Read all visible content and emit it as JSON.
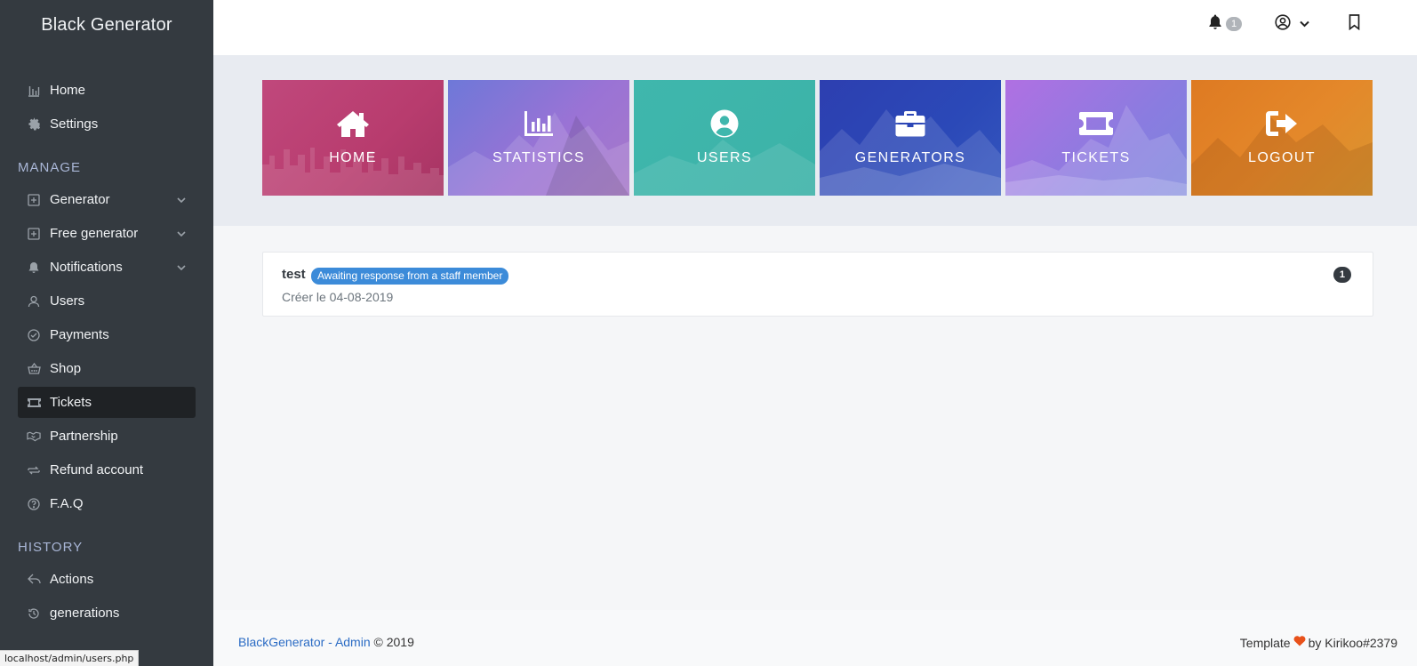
{
  "brand": "Black Generator",
  "nav_main": [
    {
      "label": "Home",
      "icon": "bar-chart-icon"
    },
    {
      "label": "Settings",
      "icon": "gear-icon"
    }
  ],
  "manage": {
    "heading": "MANAGE",
    "items": [
      {
        "label": "Generator",
        "icon": "plus-square-icon",
        "expandable": true
      },
      {
        "label": "Free generator",
        "icon": "plus-square-icon",
        "expandable": true
      },
      {
        "label": "Notifications",
        "icon": "bell-icon",
        "expandable": true
      },
      {
        "label": "Users",
        "icon": "user-icon"
      },
      {
        "label": "Payments",
        "icon": "check-circle-icon"
      },
      {
        "label": "Shop",
        "icon": "basket-icon"
      },
      {
        "label": "Tickets",
        "icon": "ticket-icon",
        "active": true
      },
      {
        "label": "Partnership",
        "icon": "handshake-icon"
      },
      {
        "label": "Refund account",
        "icon": "refresh-icon"
      },
      {
        "label": "F.A.Q",
        "icon": "question-circle-icon"
      }
    ]
  },
  "history": {
    "heading": "HISTORY",
    "items": [
      {
        "label": "Actions",
        "icon": "reply-icon"
      },
      {
        "label": "generations",
        "icon": "history-icon"
      }
    ]
  },
  "status_url": "localhost/admin/users.php",
  "topbar": {
    "notification_count": "1"
  },
  "tiles": [
    {
      "label": "HOME",
      "icon": "house-icon"
    },
    {
      "label": "STATISTICS",
      "icon": "bar-chart-icon"
    },
    {
      "label": "USERS",
      "icon": "user-circle-icon"
    },
    {
      "label": "GENERATORS",
      "icon": "briefcase-icon"
    },
    {
      "label": "TICKETS",
      "icon": "ticket-icon"
    },
    {
      "label": "LOGOUT",
      "icon": "sign-out-icon"
    }
  ],
  "ticket": {
    "title": "test",
    "status": "Awaiting response from a staff member",
    "date": "Créer le 04-08-2019",
    "count": "1"
  },
  "footer": {
    "brand_link": "BlackGenerator - Admin",
    "copyright": "© 2019",
    "template_text": "Template",
    "author_text": "by Kirikoo#2379"
  },
  "colors": {
    "sidebar": "#343a40",
    "status_badge": "#3c8bd9",
    "heart": "#e8511a"
  }
}
